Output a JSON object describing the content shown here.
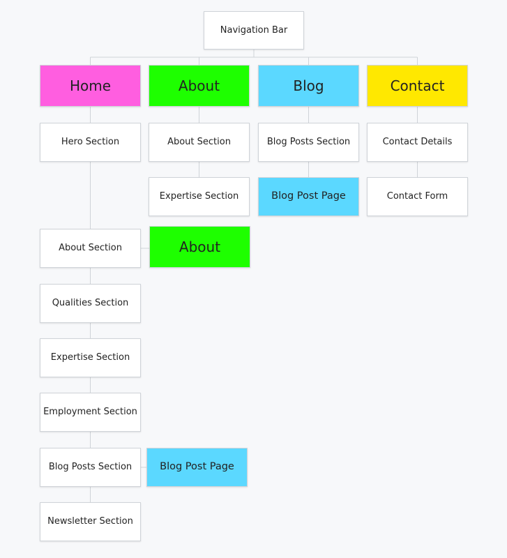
{
  "diagram": {
    "colors": {
      "background": "#f7f8fa",
      "white": "#ffffff",
      "home": "#ff5ee0",
      "about": "#1eff00",
      "blog": "#5bd8ff",
      "contact": "#ffe800",
      "connector": "#cfd3d8"
    },
    "nodes": {
      "nav_bar": "Navigation Bar",
      "home": "Home",
      "about": "About",
      "blog": "Blog",
      "contact": "Contact",
      "hero_section": "Hero Section",
      "about_section_top": "About Section",
      "blog_posts_section_top": "Blog Posts Section",
      "contact_details": "Contact Details",
      "expertise_section_top": "Expertise Section",
      "blog_post_page_top": "Blog Post Page",
      "contact_form": "Contact Form",
      "about_section": "About Section",
      "about_link": "About",
      "qualities_section": "Qualities Section",
      "expertise_section": "Expertise Section",
      "employment_section": "Employment Section",
      "blog_posts_section": "Blog Posts Section",
      "blog_post_page_link": "Blog Post Page",
      "newsletter_section": "Newsletter Section"
    }
  }
}
